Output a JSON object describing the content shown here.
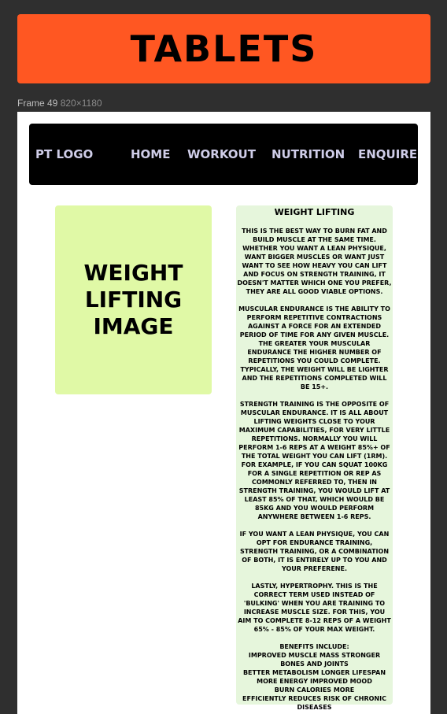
{
  "banner": {
    "title": "TABLETS"
  },
  "frame": {
    "name": "Frame 49",
    "dims": "820×1180"
  },
  "nav": {
    "logo": "PT LOGO",
    "items": [
      "HOME",
      "WORKOUT",
      "NUTRITION",
      "ENQUIRE"
    ]
  },
  "image_box": {
    "text": "WEIGHT LIFTING IMAGE"
  },
  "panel": {
    "title": "WEIGHT LIFTING",
    "paragraphs": [
      "THIS IS THE BEST WAY TO BURN FAT AND BUILD MUSCLE AT THE SAME TIME. WHETHER YOU WANT A LEAN PHYSIQUE, WANT BIGGER MUSCLES OR WANT JUST WANT TO SEE HOW HEAVY YOU CAN LIFT AND FOCUS ON STRENGTH TRAINING, IT DOESN'T MATTER WHICH ONE YOU PREFER, THEY ARE ALL GOOD VIABLE OPTIONS.",
      "MUSCULAR ENDURANCE IS THE ABILITY TO PERFORM REPETITIVE CONTRACTIONS AGAINST A FORCE FOR AN EXTENDED PERIOD OF TIME FOR ANY GIVEN MUSCLE. THE GREATER YOUR MUSCULAR ENDURANCE THE HIGHER NUMBER OF REPETITIONS YOU COULD COMPLETE. TYPICALLY, THE WEIGHT WILL BE LIGHTER AND THE REPETITIONS COMPLETED WILL BE 15+.",
      "STRENGTH TRAINING IS THE OPPOSITE OF MUSCULAR ENDURANCE. IT IS ALL ABOUT LIFTING WEIGHTS CLOSE TO YOUR MAXIMUM CAPABILITIES, FOR VERY LITTLE REPETITIONS. NORMALLY YOU WILL PERFORM 1-6 REPS AT A WEIGHT 85%+ OF THE TOTAL WEIGHT YOU CAN LIFT (1RM). FOR EXAMPLE, IF YOU CAN SQUAT 100KG FOR A SINGLE REPETITION OR REP AS COMMONLY REFERRED TO, THEN IN STRENGTH TRAINING, YOU WOULD LIFT AT LEAST 85% OF THAT, WHICH WOULD BE 85KG AND YOU WOULD PERFORM ANYWHERE BETWEEN 1-6 REPS.",
      "IF YOU WANT A LEAN PHYSIQUE, YOU CAN OPT FOR ENDURANCE TRAINING, STRENGTH TRAINING, OR A COMBINATION OF BOTH, IT IS ENTIRELY UP TO YOU AND YOUR PREFERENE.",
      "LASTLY, HYPERTROPHY. THIS IS THE CORRECT TERM USED INSTEAD OF 'BULKING' WHEN YOU ARE TRAINING TO INCREASE MUSCLE SIZE. FOR THIS, YOU AIM TO COMPLETE 8-12 REPS OF A WEIGHT 65% - 85% OF YOUR MAX WEIGHT.",
      "BENEFITS INCLUDE:\nIMPROVED MUSCLE MASS    STRONGER BONES AND JOINTS\nBETTER METABOLISM    LONGER LIFESPAN\nMORE ENERGY   IMPROVED MOOD\nBURN CALORIES MORE\nEFFICIENTLY REDUCES RISK OF CHRONIC DISEASES"
    ]
  },
  "colors": {
    "banner": "#ff5722",
    "canvas": "#2f2f2f",
    "nav_bg": "#000000",
    "nav_text": "#cfcde8",
    "image_box": "#e0f9a6",
    "panel": "#e6f6dc"
  }
}
